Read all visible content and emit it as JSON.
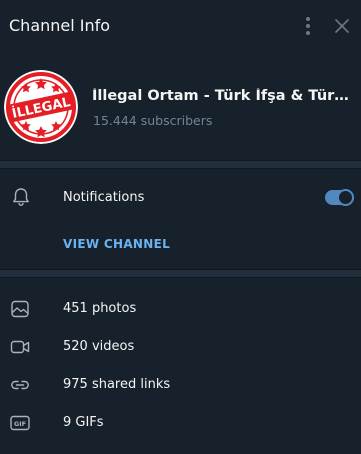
{
  "header": {
    "title": "Channel Info"
  },
  "channel": {
    "avatar_text": "İLLEGAL",
    "name": "İllegal Ortam - Türk İfşa & Türkçe İfşa",
    "subscribers": "15.444 subscribers"
  },
  "notifications": {
    "label": "Notifications",
    "enabled": true
  },
  "view_channel_label": "VIEW CHANNEL",
  "media": [
    {
      "icon": "photo-icon",
      "label": "451 photos"
    },
    {
      "icon": "video-icon",
      "label": "520 videos"
    },
    {
      "icon": "link-icon",
      "label": "975 shared links"
    },
    {
      "icon": "gif-icon",
      "label": "9 GIFs"
    }
  ],
  "colors": {
    "background": "#17212b",
    "divider": "#232e3c",
    "accent": "#5288c1",
    "link": "#6ab2f2",
    "muted_text": "#708499",
    "avatar_red": "#e31e24"
  }
}
